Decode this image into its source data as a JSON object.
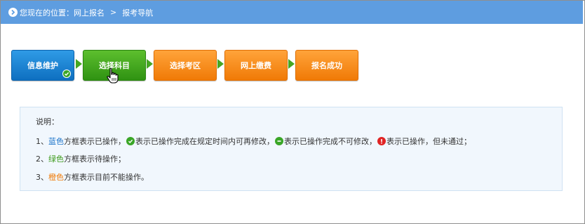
{
  "breadcrumb": {
    "prefix": "您现在的位置：网上报名",
    "separator": ">",
    "current": "报考导航"
  },
  "steps": [
    {
      "label": "信息维护",
      "color": "#0e6fc0",
      "state": "done"
    },
    {
      "label": "选择科目",
      "color": "#2f9212",
      "state": "pending"
    },
    {
      "label": "选择考区",
      "color": "#f07a06",
      "state": "unavailable"
    },
    {
      "label": "网上缴费",
      "color": "#f07a06",
      "state": "unavailable"
    },
    {
      "label": "报名成功",
      "color": "#f07a06",
      "state": "unavailable"
    }
  ],
  "note": {
    "title": "说明：",
    "line1": {
      "num": "1、",
      "color_word": "蓝色",
      "text_a": "方框表示已操作，",
      "text_b": "表示已操作完成在规定时间内可再修改，",
      "text_c": "表示已操作完成不可修改，",
      "text_d": "表示已操作，但未通过；"
    },
    "line2": {
      "num": "2、",
      "color_word": "绿色",
      "text": "方框表示待操作；"
    },
    "line3": {
      "num": "3、",
      "color_word": "橙色",
      "text": "方框表示目前不能操作。"
    }
  },
  "icons": {
    "breadcrumb": "arrow-icon",
    "done_badge": "check-icon",
    "cursor": "hand-cursor-icon",
    "modifiable": "check-circle-icon",
    "locked": "minus-circle-icon",
    "failed": "exclamation-circle-icon"
  },
  "colors": {
    "header": "#5e9de0",
    "blue": "#0e6fc0",
    "green": "#2f9212",
    "orange": "#f07a06",
    "note_bg": "#f1f7fd"
  }
}
